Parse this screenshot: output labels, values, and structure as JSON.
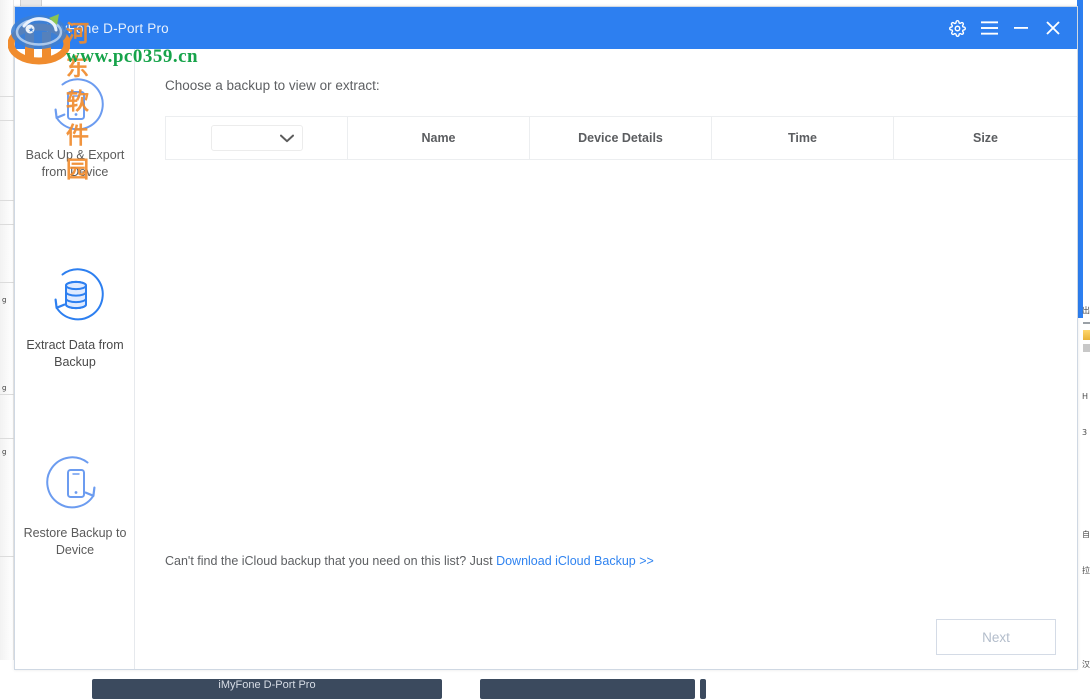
{
  "window": {
    "title": "iMyFone D-Port Pro",
    "accent_color": "#2d7ff0",
    "controls": [
      {
        "name": "settings",
        "icon": "gear-icon",
        "label": "Settings"
      },
      {
        "name": "menu",
        "icon": "hamburger-menu-icon",
        "label": "Menu"
      },
      {
        "name": "minimize",
        "icon": "minimize-icon",
        "label": "Minimize"
      },
      {
        "name": "close",
        "icon": "close-icon",
        "label": "Close"
      }
    ]
  },
  "sidebar": {
    "items": [
      {
        "label": "Back Up & Export from Device",
        "icon": "phone-backup-icon",
        "active": false
      },
      {
        "label": "Extract Data from Backup",
        "icon": "database-restore-icon",
        "active": true
      },
      {
        "label": "Restore Backup to Device",
        "icon": "phone-restore-icon",
        "active": false
      }
    ]
  },
  "main": {
    "prompt": "Choose a backup to view or extract:",
    "table": {
      "filter_value": "",
      "filter_placeholder": "",
      "columns": [
        "",
        "Name",
        "Device Details",
        "Time",
        "Size"
      ],
      "rows": []
    },
    "hint": {
      "text": "Can't find the iCloud backup that you need on this list? Just ",
      "link": "Download iCloud Backup >>"
    },
    "next_button": {
      "label": "Next",
      "disabled": true
    }
  },
  "watermark": {
    "chinese": "河东软件园",
    "url": "www.pc0359.cn"
  },
  "taskbar": {
    "items": [
      {
        "label": "iMyFone D-Port Pro"
      },
      {
        "label": ""
      }
    ]
  }
}
